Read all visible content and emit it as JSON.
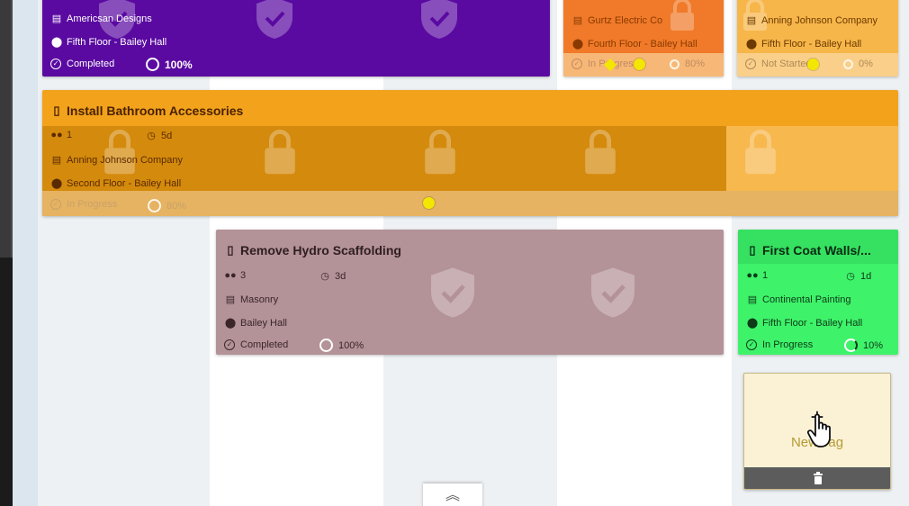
{
  "colors": {
    "purple": "#5a0aa1",
    "orange_dark": "#f07a29",
    "orange": "#f3a21c",
    "orange_light": "#f7b64a",
    "mauve": "#b39298",
    "green": "#3ef26a",
    "new_tag_bg": "#fbf2d6"
  },
  "cards": {
    "american": {
      "company": "Americsan Designs",
      "location": "Fifth Floor - Bailey Hall",
      "status": "Completed",
      "progress": "100%"
    },
    "gurtz": {
      "company": "Gurtz Electric Co",
      "location": "Fourth Floor - Bailey Hall",
      "status": "In Progress",
      "progress": "80%"
    },
    "anning_top": {
      "company": "Anning Johnson Company",
      "location": "Fifth Floor - Bailey Hall",
      "status": "Not Started",
      "progress": "0%"
    },
    "bathroom": {
      "title": "Install Bathroom Accessories",
      "crew": "1",
      "duration": "5d",
      "company": "Anning Johnson Company",
      "location": "Second Floor - Bailey Hall",
      "status": "In Progress",
      "progress": "80%"
    },
    "hydro": {
      "title": "Remove Hydro Scaffolding",
      "crew": "3",
      "duration": "3d",
      "company": "Masonry",
      "location": "Bailey Hall",
      "status": "Completed",
      "progress": "100%"
    },
    "coat": {
      "title": "First Coat Walls/...",
      "crew": "1",
      "duration": "1d",
      "company": "Continental Painting",
      "location": "Fifth Floor - Bailey Hall",
      "status": "In Progress",
      "progress": "10%"
    }
  },
  "new_tag": {
    "plus": "+",
    "label": "New Tag"
  },
  "scroll_top": {
    "glyph": "︽"
  }
}
